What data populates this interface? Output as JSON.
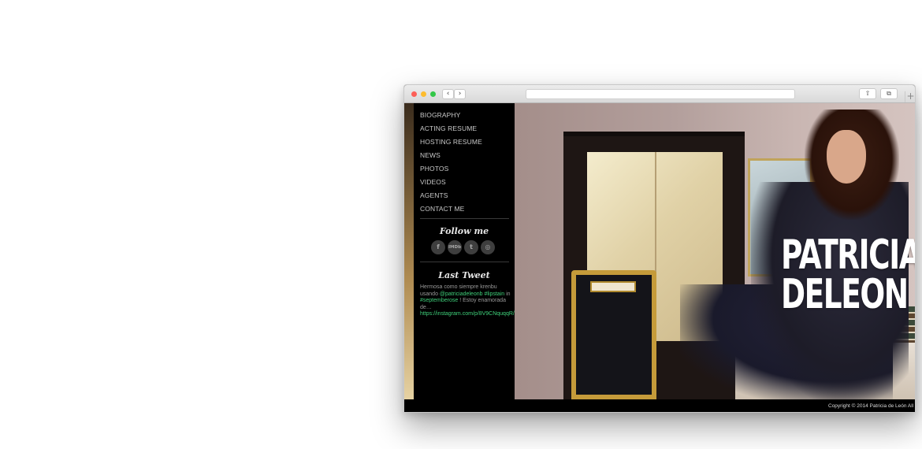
{
  "nav": {
    "items": [
      "BIOGRAPHY",
      "ACTING RESUME",
      "HOSTING RESUME",
      "NEWS",
      "PHOTOS",
      "VIDEOS",
      "AGENTS",
      "CONTACT ME"
    ]
  },
  "follow": {
    "heading": "Follow me",
    "icons": [
      "facebook-icon",
      "imdb-icon",
      "twitter-icon",
      "instagram-icon"
    ],
    "icon_glyphs": {
      "facebook": "f",
      "imdb": "IMDb",
      "twitter": "t",
      "instagram": "◎"
    }
  },
  "tweet": {
    "heading": "Last Tweet",
    "text_1": "Hermosa como siempre krenbu usando ",
    "mention": "@patriciadeleonb",
    "hashtag_1": "#lipstain",
    "text_2": " in ",
    "hashtag_2": "#septemberose",
    "text_3": " ! Estoy enamorada de…",
    "link": "https://instagram.com/p/8V9CNquqqR/"
  },
  "hero": {
    "title_line1": "PATRICIA",
    "title_line2": "DELEON"
  },
  "footer": {
    "copyright": "Copyright © 2014 Patricia de León All rights reserved"
  },
  "chrome": {
    "back_glyph": "‹",
    "forward_glyph": "›",
    "share_glyph": "⇧",
    "tabs_glyph": "⧉",
    "new_tab_glyph": "+"
  },
  "colors": {
    "accent_link": "#3fd07a",
    "sidebar_bg": "#000000"
  }
}
